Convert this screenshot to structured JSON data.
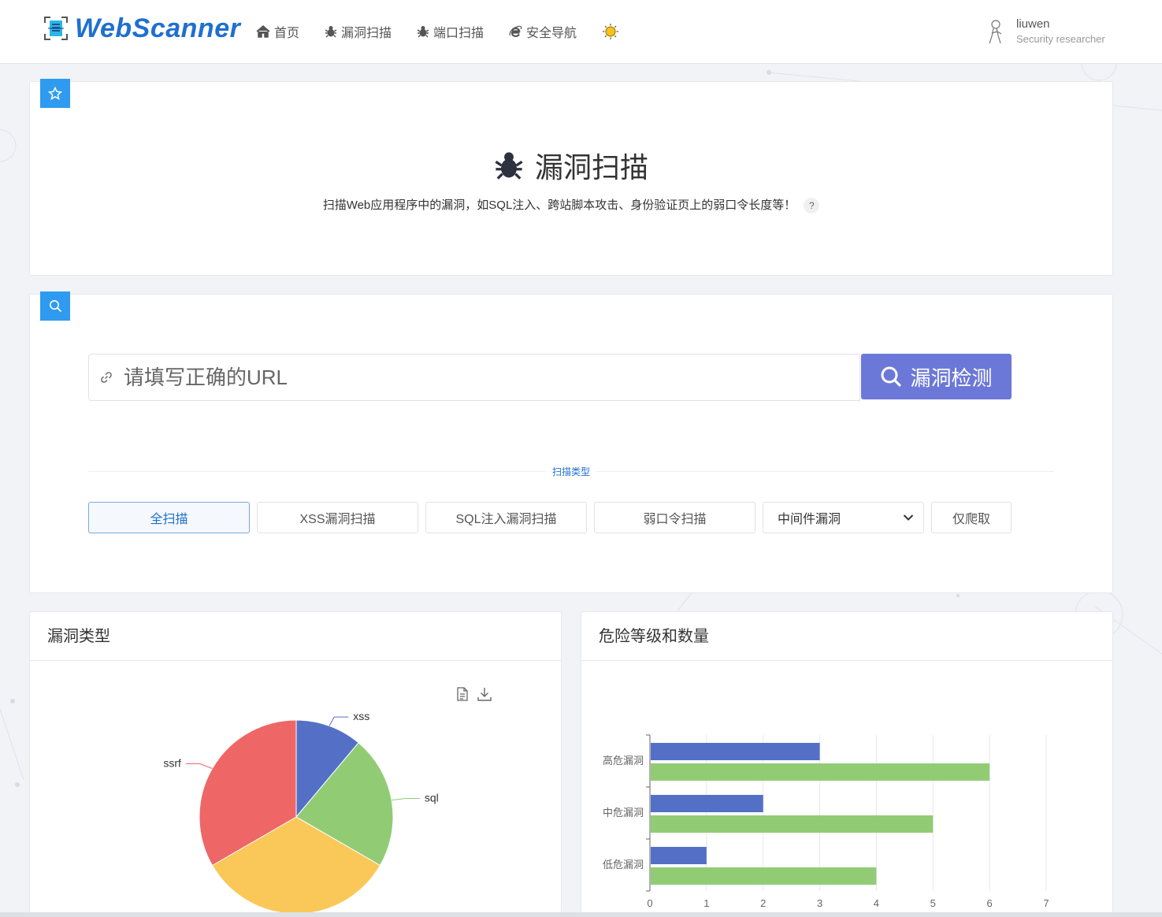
{
  "brand": {
    "name": "WebScanner"
  },
  "nav": [
    {
      "label": "首页",
      "icon": "home-icon"
    },
    {
      "label": "漏洞扫描",
      "icon": "bug-icon"
    },
    {
      "label": "端口扫描",
      "icon": "bug-icon"
    },
    {
      "label": "安全导航",
      "icon": "browser-e-icon"
    },
    {
      "label": "",
      "icon": "sun-icon"
    }
  ],
  "user": {
    "name": "liuwen",
    "role": "Security researcher"
  },
  "hero": {
    "title": "漏洞扫描",
    "description": "扫描Web应用程序中的漏洞，如SQL注入、跨站脚本攻击、身份验证页上的弱口令长度等！",
    "help": "?"
  },
  "search": {
    "placeholder": "请填写正确的URL",
    "button_label": "漏洞检测"
  },
  "scan_types": {
    "divider_label": "扫描类型",
    "full": "全扫描",
    "xss": "XSS漏洞扫描",
    "sql": "SQL注入漏洞扫描",
    "weak": "弱口令扫描",
    "middleware": "中间件漏洞",
    "crawl": "仅爬取"
  },
  "panels": {
    "pie_title": "漏洞类型",
    "bar_title": "危险等级和数量"
  },
  "chart_data": [
    {
      "type": "pie",
      "categories": [
        "xss",
        "sql",
        "ssrf"
      ],
      "values": [
        1,
        2,
        3,
        3
      ],
      "slices": [
        {
          "label": "xss",
          "value": 1,
          "color": "#5470c6"
        },
        {
          "label": "sql",
          "value": 2,
          "color": "#91cc75"
        },
        {
          "label": "",
          "value": 3,
          "color": "#fac858"
        },
        {
          "label": "ssrf",
          "value": 3,
          "color": "#ee6666"
        }
      ]
    },
    {
      "type": "bar",
      "orientation": "horizontal",
      "categories": [
        "高危漏洞",
        "中危漏洞",
        "低危漏洞"
      ],
      "series": [
        {
          "values": [
            3,
            2,
            1
          ],
          "color": "#5470c6"
        },
        {
          "values": [
            6,
            5,
            4
          ],
          "color": "#91cc75"
        }
      ],
      "xlim": [
        0,
        7
      ],
      "xticks": [
        "0",
        "1",
        "2",
        "3",
        "4",
        "5",
        "6",
        "7"
      ],
      "grid": true
    }
  ]
}
